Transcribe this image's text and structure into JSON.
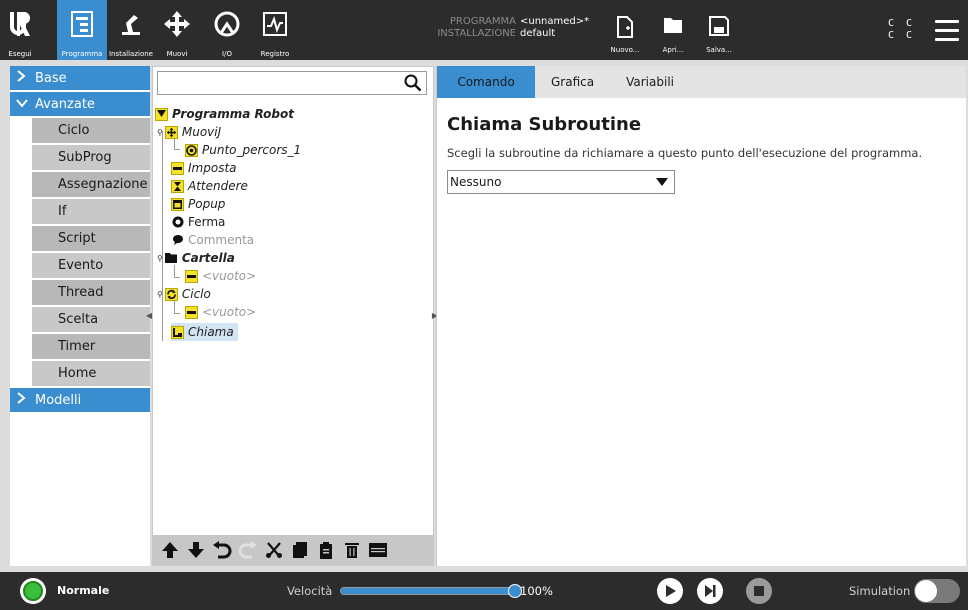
{
  "nav": {
    "run": "Esegui",
    "program": "Programma",
    "installation": "Installazione",
    "move": "Muovi",
    "io": "I/O",
    "log": "Registro"
  },
  "file": {
    "program_label": "PROGRAMMA",
    "program_value": "<unnamed>*",
    "installation_label": "INSTALLAZIONE",
    "installation_value": "default",
    "new": "Nuovo...",
    "open": "Apri...",
    "save": "Salva..."
  },
  "cc_text": "C C\nC C",
  "sidebar": {
    "base": "Base",
    "advanced": "Avanzate",
    "advanced_items": [
      "Ciclo",
      "SubProg",
      "Assegnazione",
      "If",
      "Script",
      "Evento",
      "Thread",
      "Scelta",
      "Timer",
      "Home"
    ],
    "templates": "Modelli"
  },
  "search": {
    "placeholder": ""
  },
  "tree": {
    "root": "Programma Robot",
    "movej": "MuoviJ",
    "waypoint": "Punto_percors_1",
    "set": "Imposta",
    "wait": "Attendere",
    "popup": "Popup",
    "halt": "Ferma",
    "comment": "Commenta",
    "folder": "Cartella",
    "empty1": "<vuoto>",
    "loop": "Ciclo",
    "empty2": "<vuoto>",
    "call": "Chiama"
  },
  "tabs": {
    "command": "Comando",
    "graphics": "Grafica",
    "variables": "Variabili"
  },
  "content": {
    "title": "Chiama Subroutine",
    "description": "Scegli la subroutine da richiamare a questo punto dell'esecuzione del programma.",
    "selected": "Nessuno"
  },
  "bottom": {
    "status": "Normale",
    "speed_label": "Velocità",
    "speed_value": "100%",
    "speed_fraction": 1.0,
    "simulation_label": "Simulation"
  },
  "colors": {
    "accent": "#3a8ed0",
    "topbar": "#2c2c2c",
    "status_ok": "#3bbf3b",
    "node_yellow": "#f5e12a"
  }
}
